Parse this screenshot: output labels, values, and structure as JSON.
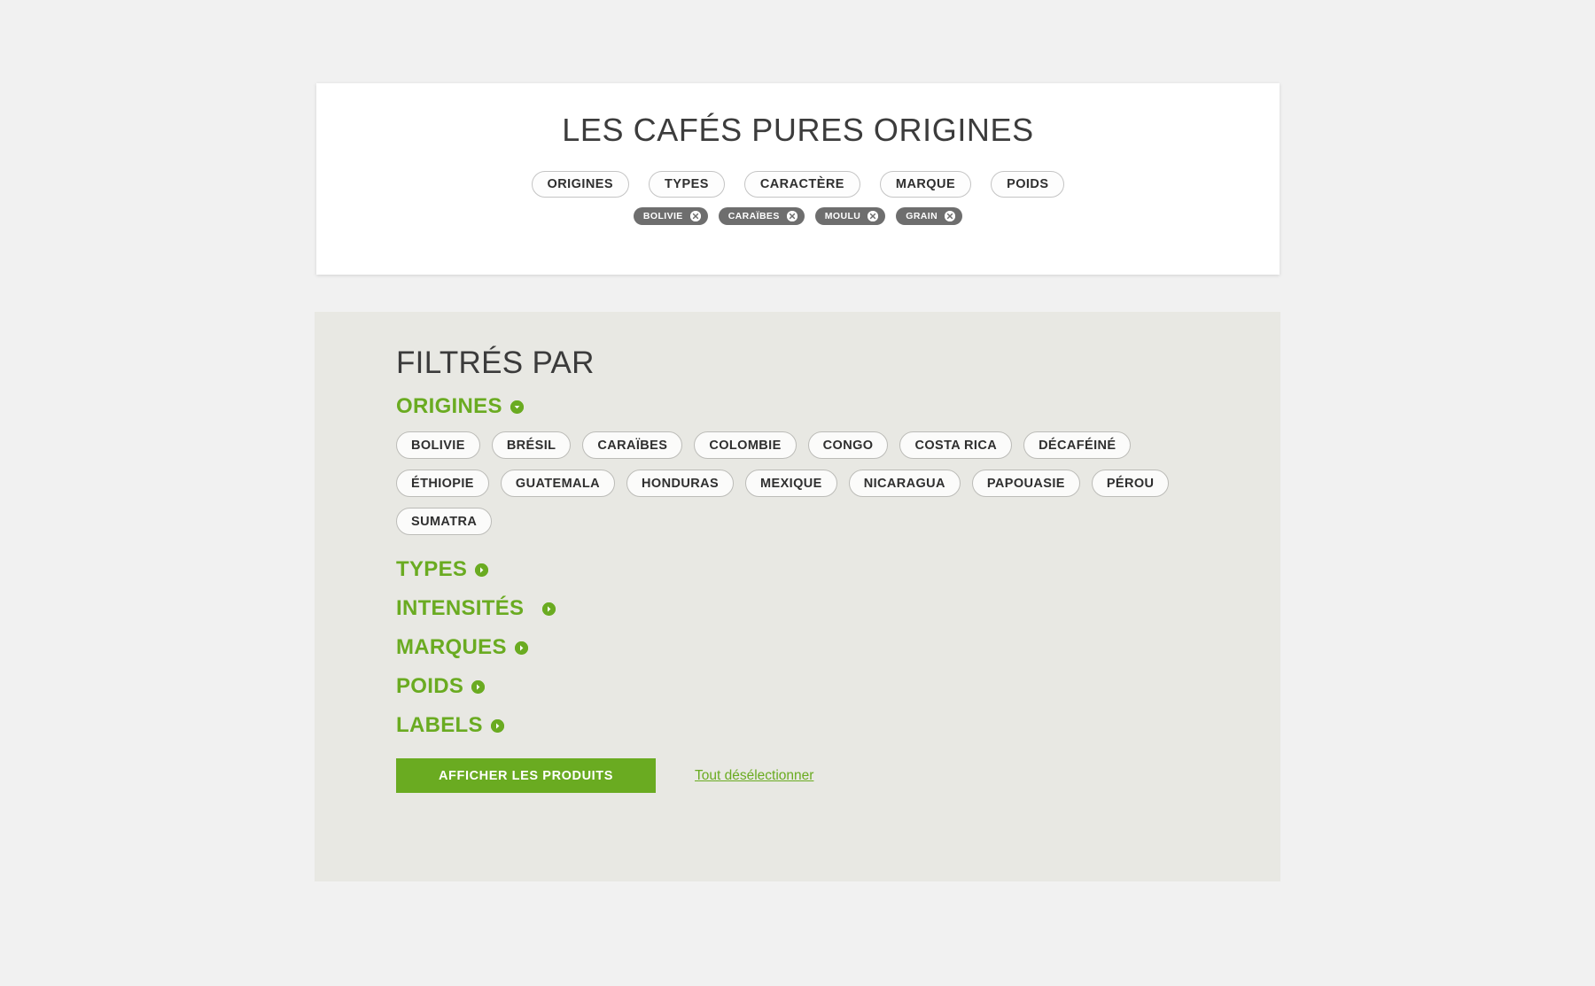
{
  "theme": {
    "page_background": "#f1f1f1",
    "panel_background": "#e8e8e3",
    "accent_green": "#6aab21",
    "chip_grey": "#6e6e6e",
    "text_dark": "#3b3b3b"
  },
  "header": {
    "title": "LES CAFÉS PURES ORIGINES",
    "nav": [
      {
        "label": "ORIGINES"
      },
      {
        "label": "TYPES"
      },
      {
        "label": "CARACTÈRE"
      },
      {
        "label": "MARQUE"
      },
      {
        "label": "POIDS"
      }
    ],
    "selected_chips": [
      {
        "label": "BOLIVIE",
        "remove_icon": "close-circle-icon"
      },
      {
        "label": "CARAÏBES",
        "remove_icon": "close-circle-icon"
      },
      {
        "label": "MOULU",
        "remove_icon": "close-circle-icon"
      },
      {
        "label": "GRAIN",
        "remove_icon": "close-circle-icon"
      }
    ]
  },
  "filters": {
    "title": "FILTRÉS PAR",
    "origines": {
      "label": "ORIGINES",
      "expanded": true,
      "toggle_icon": "chevron-down-circle-icon",
      "options": [
        {
          "label": "BOLIVIE"
        },
        {
          "label": "BRÉSIL"
        },
        {
          "label": "CARAÏBES"
        },
        {
          "label": "COLOMBIE"
        },
        {
          "label": "CONGO"
        },
        {
          "label": "COSTA RICA"
        },
        {
          "label": "DÉCAFÉINÉ"
        },
        {
          "label": "ÉTHIOPIE"
        },
        {
          "label": "GUATEMALA"
        },
        {
          "label": "HONDURAS"
        },
        {
          "label": "MEXIQUE"
        },
        {
          "label": "NICARAGUA"
        },
        {
          "label": "PAPOUASIE"
        },
        {
          "label": "PÉROU"
        },
        {
          "label": "SUMATRA"
        }
      ]
    },
    "collapsed_groups": [
      {
        "label": "TYPES",
        "toggle_icon": "chevron-right-circle-icon"
      },
      {
        "label": "INTENSITÉS",
        "toggle_icon": "chevron-right-circle-icon"
      },
      {
        "label": "MARQUES",
        "toggle_icon": "chevron-right-circle-icon"
      },
      {
        "label": "POIDS",
        "toggle_icon": "chevron-right-circle-icon"
      },
      {
        "label": "LABELS",
        "toggle_icon": "chevron-right-circle-icon"
      }
    ],
    "actions": {
      "show_products_label": "AFFICHER LES PRODUITS",
      "clear_all_label": "Tout désélectionner"
    }
  }
}
